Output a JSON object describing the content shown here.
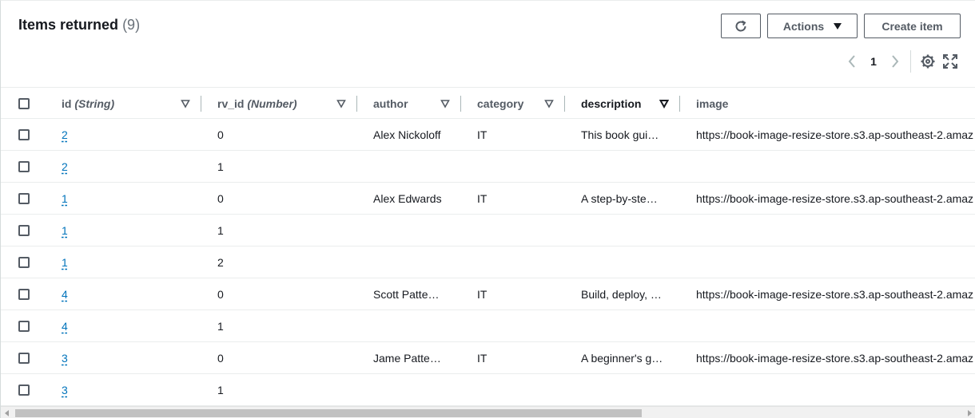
{
  "header": {
    "title": "Items returned",
    "count": "(9)"
  },
  "toolbar": {
    "refresh_icon": "refresh-icon",
    "actions_label": "Actions",
    "create_label": "Create item"
  },
  "pagination": {
    "current_page": "1"
  },
  "table": {
    "columns": [
      {
        "name": "id",
        "type": "(String)"
      },
      {
        "name": "rv_id",
        "type": "(Number)"
      },
      {
        "name": "author",
        "type": ""
      },
      {
        "name": "category",
        "type": ""
      },
      {
        "name": "description",
        "type": ""
      },
      {
        "name": "image",
        "type": ""
      }
    ],
    "rows": [
      {
        "id": "2",
        "rv_id": "0",
        "author": "Alex Nickoloff",
        "category": "IT",
        "description": "This book gui…",
        "image": "https://book-image-resize-store.s3.ap-southeast-2.amaz"
      },
      {
        "id": "2",
        "rv_id": "1",
        "author": "",
        "category": "",
        "description": "",
        "image": ""
      },
      {
        "id": "1",
        "rv_id": "0",
        "author": "Alex Edwards",
        "category": "IT",
        "description": "A step-by-ste…",
        "image": "https://book-image-resize-store.s3.ap-southeast-2.amaz"
      },
      {
        "id": "1",
        "rv_id": "1",
        "author": "",
        "category": "",
        "description": "",
        "image": ""
      },
      {
        "id": "1",
        "rv_id": "2",
        "author": "",
        "category": "",
        "description": "",
        "image": ""
      },
      {
        "id": "4",
        "rv_id": "0",
        "author": "Scott Patte…",
        "category": "IT",
        "description": "Build, deploy, …",
        "image": "https://book-image-resize-store.s3.ap-southeast-2.amaz"
      },
      {
        "id": "4",
        "rv_id": "1",
        "author": "",
        "category": "",
        "description": "",
        "image": ""
      },
      {
        "id": "3",
        "rv_id": "0",
        "author": "Jame Patte…",
        "category": "IT",
        "description": "A beginner's g…",
        "image": "https://book-image-resize-store.s3.ap-southeast-2.amaz"
      },
      {
        "id": "3",
        "rv_id": "1",
        "author": "",
        "category": "",
        "description": "",
        "image": ""
      }
    ]
  },
  "colors": {
    "link": "#0073bb",
    "text": "#16191f",
    "muted": "#545b64",
    "border": "#eaeded"
  }
}
